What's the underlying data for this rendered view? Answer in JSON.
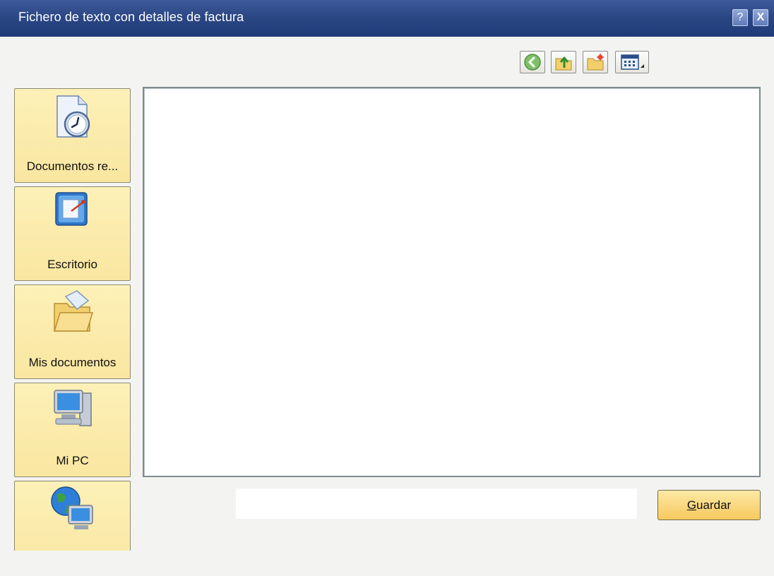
{
  "window": {
    "title": "Fichero de texto con detalles de factura",
    "help_label": "?",
    "close_label": "X"
  },
  "toolbar": {
    "buttons": [
      {
        "name": "back",
        "icon": "back-arrow-icon"
      },
      {
        "name": "up-folder",
        "icon": "folder-up-icon"
      },
      {
        "name": "new-folder",
        "icon": "new-folder-icon"
      },
      {
        "name": "view-menu",
        "icon": "view-menu-icon"
      }
    ]
  },
  "places": [
    {
      "label": "Documentos re...",
      "icon": "recent-documents-icon"
    },
    {
      "label": "Escritorio",
      "icon": "desktop-icon"
    },
    {
      "label": "Mis documentos",
      "icon": "my-documents-icon"
    },
    {
      "label": "Mi PC",
      "icon": "my-computer-icon"
    },
    {
      "label": "",
      "icon": "network-places-icon"
    }
  ],
  "file_name": {
    "value": "",
    "placeholder": ""
  },
  "save_button": {
    "label_prefix": "G",
    "label_rest": "uardar"
  },
  "colors": {
    "titlebar": "#2b4784",
    "place_button": "#fbeaa8",
    "save_button": "#f6c95d",
    "background": "#f3f3f1"
  }
}
